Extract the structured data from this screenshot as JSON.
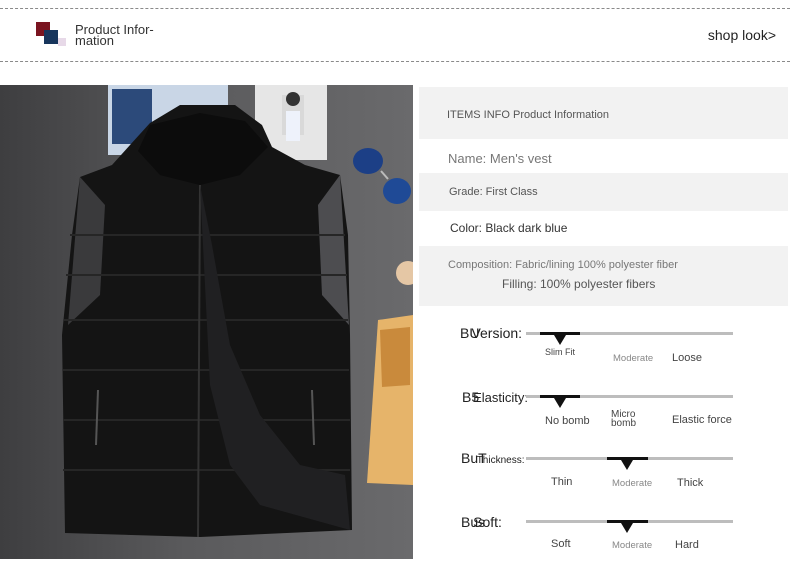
{
  "header": {
    "title_line1": "Product Infor-",
    "title_line2": "mation",
    "shop_look": "shop look>"
  },
  "info": {
    "section_title": "ITEMS INFO Product Information",
    "name": "Name: Men's vest",
    "grade": "Grade: First Class",
    "color": "Color: Black dark blue",
    "composition": "Composition: Fabric/lining 100% polyester fiber",
    "filling": "Filling: 100% polyester fibers"
  },
  "scales": [
    {
      "label": "Version:",
      "prefix": "BU",
      "level": 0.12,
      "options": [
        "Slim Fit",
        "Moderate",
        "Loose"
      ]
    },
    {
      "label": "Elasticity:",
      "prefix": "B5",
      "level": 0.12,
      "options": [
        "No bomb",
        "Micro bomb",
        "Elastic force"
      ]
    },
    {
      "label": "Thickness:",
      "prefix": "BuT",
      "level": 0.5,
      "options": [
        "Thin",
        "Moderate",
        "Thick"
      ]
    },
    {
      "label": "Soft:",
      "prefix": "Bus",
      "level": 0.5,
      "options": [
        "Soft",
        "Moderate",
        "Hard"
      ]
    }
  ],
  "colors": {
    "accent_red": "#7a1420",
    "accent_blue": "#17355c",
    "panel": "#f2f2f2"
  }
}
